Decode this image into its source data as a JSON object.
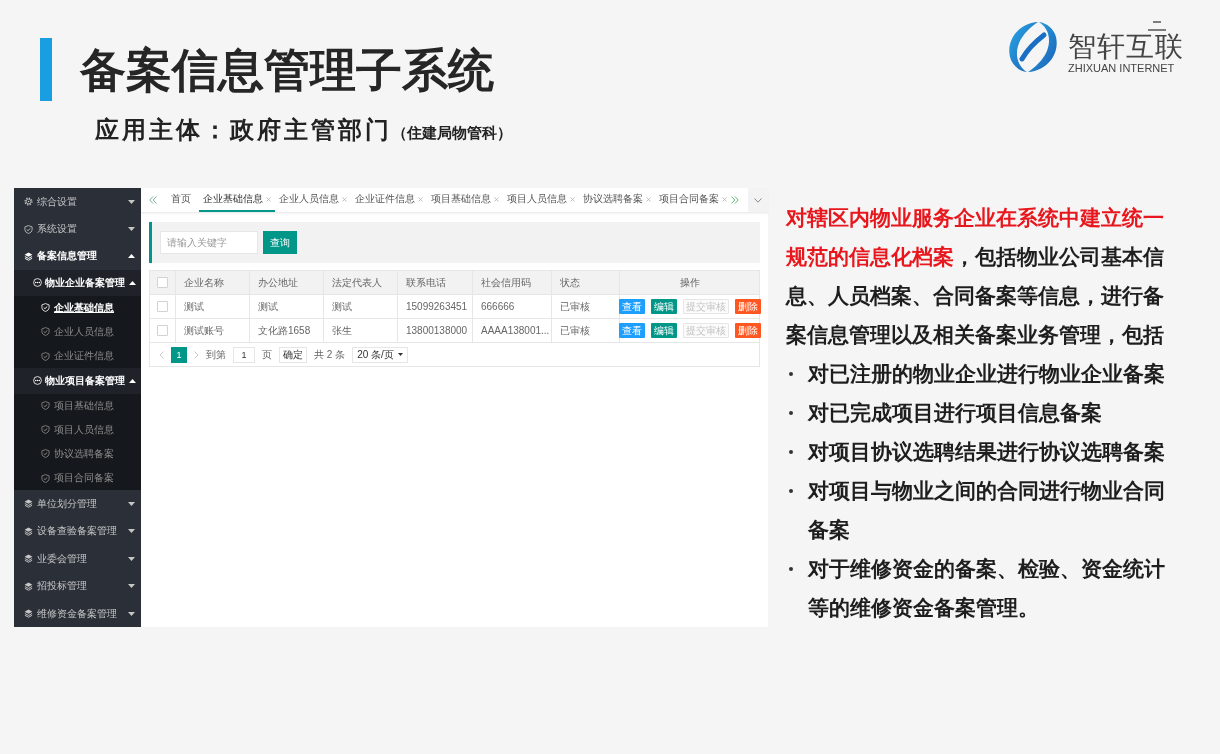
{
  "header": {
    "title": "备案信息管理子系统",
    "subtitle": "应用主体：政府主管部门",
    "subtitle_note": "（住建局物管科）"
  },
  "logo": {
    "name": "智轩互联",
    "tagline": "ZHIXUAN INTERNET"
  },
  "app": {
    "sidebar": {
      "items": [
        {
          "label": "综合设置",
          "kind": "settings",
          "expanded": false,
          "selected": false
        },
        {
          "label": "系统设置",
          "kind": "system",
          "expanded": false,
          "selected": false
        },
        {
          "label": "备案信息管理",
          "kind": "module",
          "expanded": true,
          "selected": false,
          "children": [
            {
              "label": "物业企业备案管理",
              "expanded": true,
              "selected": false,
              "children": [
                {
                  "label": "企业基础信息",
                  "selected": true
                },
                {
                  "label": "企业人员信息",
                  "selected": false
                },
                {
                  "label": "企业证件信息",
                  "selected": false
                }
              ]
            },
            {
              "label": "物业项目备案管理",
              "expanded": true,
              "selected": false,
              "children": [
                {
                  "label": "项目基础信息",
                  "selected": false
                },
                {
                  "label": "项目人员信息",
                  "selected": false
                },
                {
                  "label": "协议选聘备案",
                  "selected": false
                },
                {
                  "label": "项目合同备案",
                  "selected": false
                }
              ]
            }
          ]
        },
        {
          "label": "单位划分管理",
          "kind": "module",
          "expanded": false,
          "selected": false
        },
        {
          "label": "设备查验备案管理",
          "kind": "module",
          "expanded": false,
          "selected": false
        },
        {
          "label": "业委会管理",
          "kind": "module",
          "expanded": false,
          "selected": false
        },
        {
          "label": "招投标管理",
          "kind": "module",
          "expanded": false,
          "selected": false
        },
        {
          "label": "维修资金备案管理",
          "kind": "module",
          "expanded": false,
          "selected": false
        }
      ]
    },
    "tabs": [
      {
        "label": "首页",
        "selected": false,
        "closable": false
      },
      {
        "label": "企业基础信息",
        "selected": true,
        "closable": true
      },
      {
        "label": "企业人员信息",
        "selected": false,
        "closable": true
      },
      {
        "label": "企业证件信息",
        "selected": false,
        "closable": true
      },
      {
        "label": "项目基础信息",
        "selected": false,
        "closable": true
      },
      {
        "label": "项目人员信息",
        "selected": false,
        "closable": true
      },
      {
        "label": "协议选聘备案",
        "selected": false,
        "closable": true
      },
      {
        "label": "项目合同备案",
        "selected": false,
        "closable": true
      }
    ],
    "search": {
      "placeholder": "请输入关键字",
      "button": "查询"
    },
    "table": {
      "select_all": {
        "checked": false
      },
      "columns": [
        "企业名称",
        "办公地址",
        "法定代表人",
        "联系电话",
        "社会信用码",
        "状态",
        "操作"
      ],
      "rows": [
        {
          "checked": false,
          "cells": [
            "测试",
            "测试",
            "测试",
            "15099263451",
            "666666",
            "已审核"
          ],
          "actions": [
            {
              "label": "查看",
              "kind": "view",
              "disabled": false
            },
            {
              "label": "编辑",
              "kind": "edit",
              "disabled": false
            },
            {
              "label": "提交审核",
              "kind": "submit",
              "disabled": true
            },
            {
              "label": "删除",
              "kind": "delete",
              "disabled": false
            }
          ]
        },
        {
          "checked": false,
          "cells": [
            "测试账号",
            "文化路1658",
            "张生",
            "13800138000",
            "AAAA138001...",
            "已审核"
          ],
          "actions": [
            {
              "label": "查看",
              "kind": "view",
              "disabled": false
            },
            {
              "label": "编辑",
              "kind": "edit",
              "disabled": false
            },
            {
              "label": "提交审核",
              "kind": "submit",
              "disabled": true
            },
            {
              "label": "删除",
              "kind": "delete",
              "disabled": false
            }
          ]
        }
      ]
    },
    "pagination": {
      "prev": {
        "disabled": true
      },
      "pages": [
        {
          "label": "1",
          "selected": true
        }
      ],
      "next": {
        "disabled": true
      },
      "goto_label": "到第",
      "goto_value": "1",
      "page_unit": "页",
      "confirm": "确定",
      "total": "共 2 条",
      "page_size": "20 条/页"
    }
  },
  "description": {
    "highlight": "对辖区内物业服务企业在系统中建立统一规范的信息化档案",
    "text": "，包括物业公司基本信息、人员档案、合同备案等信息，进行备案信息管理以及相关备案业务管理，包括",
    "bullets": [
      "对已注册的物业企业进行物业企业备案",
      "对已完成项目进行项目信息备案",
      "对项目协议选聘结果进行协议选聘备案",
      "对项目与物业之间的合同进行物业合同备案",
      "对于维修资金的备案、检验、资金统计等的维修资金备案管理。"
    ]
  }
}
